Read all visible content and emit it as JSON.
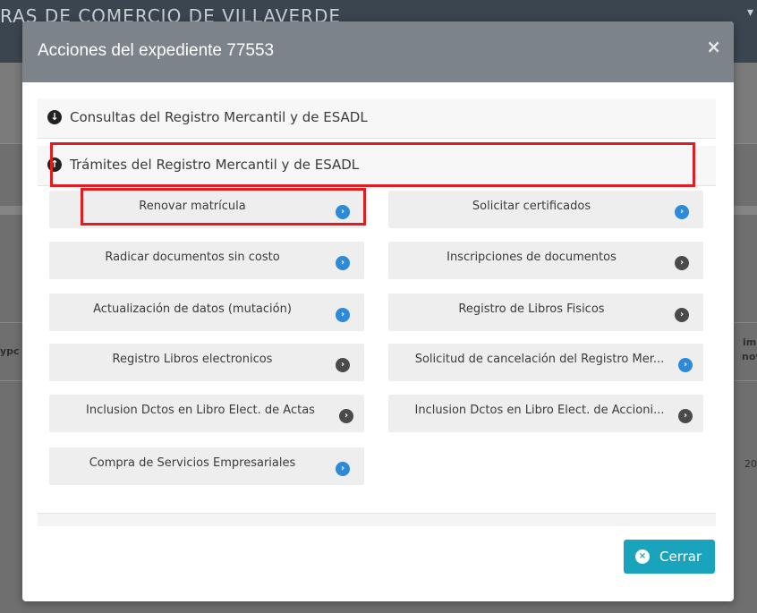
{
  "background": {
    "title": "RAS DE COMERCIO DE VILLAVERDE",
    "side_text_left_1": "ypc",
    "side_text_right_1": "im",
    "side_text_right_2": "nov",
    "side_text_right_3": "20"
  },
  "modal": {
    "title": "Acciones del expediente 77553",
    "close_glyph": "×",
    "sections": [
      {
        "label": "Consultas del Registro Mercantil y de ESADL",
        "icon": "arrow-down-circle-icon",
        "expanded": false
      },
      {
        "label": "Trámites del Registro Mercantil y de ESADL",
        "icon": "arrow-up-circle-icon",
        "expanded": true
      }
    ],
    "actions": [
      {
        "label": "Renovar matrícula",
        "icon_color": "blue"
      },
      {
        "label": "Solicitar certificados",
        "icon_color": "blue"
      },
      {
        "label": "Radicar documentos sin costo",
        "icon_color": "blue"
      },
      {
        "label": "Inscripciones de documentos",
        "icon_color": "dark"
      },
      {
        "label": "Actualización de datos (mutación)",
        "icon_color": "blue"
      },
      {
        "label": "Registro de Libros Fisicos",
        "icon_color": "dark"
      },
      {
        "label": "Registro Libros electronicos",
        "icon_color": "dark"
      },
      {
        "label": "Solicitud de cancelación del Registro Mer...",
        "icon_color": "blue"
      },
      {
        "label": "Inclusion Dctos en Libro Elect. de Actas",
        "icon_color": "dark"
      },
      {
        "label": "Inclusion Dctos en Libro Elect. de Accioni...",
        "icon_color": "dark"
      },
      {
        "label": "Compra de Servicios Empresariales",
        "icon_color": "blue"
      }
    ],
    "footer": {
      "close_label": "Cerrar",
      "close_glyph": "×"
    },
    "go_glyph": "›",
    "arrow_down_glyph": "↓",
    "arrow_up_glyph": "↑"
  },
  "colors": {
    "header": "#7c838b",
    "highlight": "#e01e22",
    "primary_button": "#1aa3bd",
    "icon_blue": "#2d8ad8",
    "icon_dark": "#4a4a4a"
  }
}
